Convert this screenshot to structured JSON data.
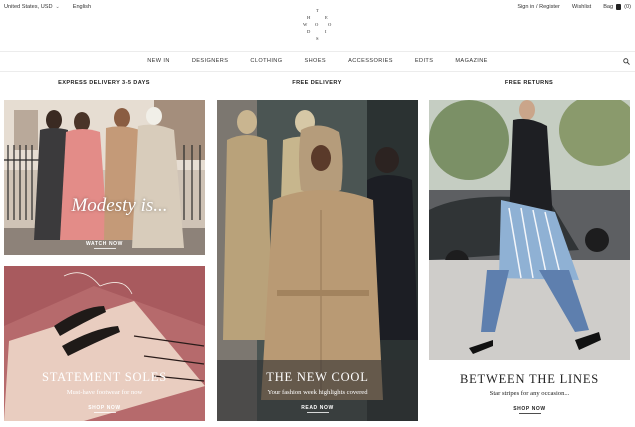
{
  "topbar": {
    "currency": "United States, USD",
    "language": "English",
    "signin": "Sign in / Register",
    "wishlist": "Wishlist",
    "bag_label": "Bag",
    "bag_count": "(0)"
  },
  "logo": {
    "letters": [
      "T",
      "H",
      "E",
      "W",
      "O",
      "O",
      "D",
      "I",
      "S"
    ]
  },
  "nav": {
    "items": [
      "NEW IN",
      "DESIGNERS",
      "CLOTHING",
      "SHOES",
      "ACCESSORIES",
      "EDITS",
      "MAGAZINE"
    ],
    "search_icon": "search-icon"
  },
  "usp": [
    "EXPRESS DELIVERY 3-5 DAYS",
    "FREE DELIVERY",
    "FREE RETURNS"
  ],
  "tiles": {
    "modesty": {
      "title": "Modesty is...",
      "cta": "WATCH NOW"
    },
    "soles": {
      "title": "STATEMENT SOLES",
      "subtitle": "Must-have footwear for now",
      "cta": "SHOP NOW"
    },
    "cool": {
      "title": "THE NEW COOL",
      "subtitle": "Your fashion week highlights covered",
      "cta": "READ NOW"
    },
    "lines": {
      "title": "BETWEEN THE LINES",
      "subtitle": "Star stripes for any occasion...",
      "cta": "SHOP NOW"
    }
  },
  "colors": {
    "accent": "#222222",
    "soles_bg": "#a85a5e",
    "lines_panel": "#ffffff"
  }
}
